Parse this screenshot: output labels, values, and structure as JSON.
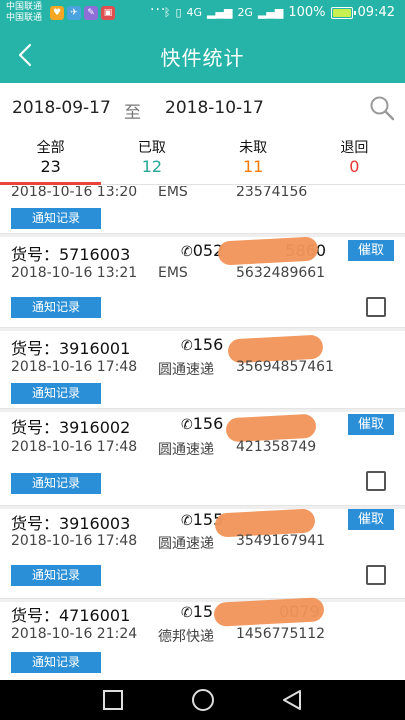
{
  "status_bar": {
    "carrier_1": "中国联通",
    "carrier_2": "中国联通",
    "dots": "···",
    "net_4g": "4G",
    "net_2g": "2G",
    "battery_text": "100%",
    "time": "09:42"
  },
  "header": {
    "title": "快件统计"
  },
  "date_range": {
    "start": "2018-09-17",
    "separator": "至",
    "end": "2018-10-17"
  },
  "tabs": [
    {
      "label": "全部",
      "count": "23",
      "color": "#111111"
    },
    {
      "label": "已取",
      "count": "12",
      "color": "#26a69a"
    },
    {
      "label": "未取",
      "count": "11",
      "color": "#f57c00"
    },
    {
      "label": "退回",
      "count": "0",
      "color": "#e53935"
    }
  ],
  "labels": {
    "notify": "通知记录",
    "urge": "催取",
    "phone_icon": "✆"
  },
  "items": [
    {
      "time": "2018-10-16 13:20",
      "company": "EMS",
      "tracking": "23574156"
    },
    {
      "parcel": "货号：5716003",
      "phone": "052",
      "phone_tail": "5860",
      "time": "2018-10-16 13:21",
      "company": "EMS",
      "tracking": "5632489661"
    },
    {
      "parcel": "货号：3916001",
      "phone": "156",
      "time": "2018-10-16 17:48",
      "company": "圆通速递",
      "tracking": "35694857461"
    },
    {
      "parcel": "货号：3916002",
      "phone": "156",
      "time": "2018-10-16 17:48",
      "company": "圆通速递",
      "tracking": "421358749"
    },
    {
      "parcel": "货号：3916003",
      "phone": "155",
      "time": "2018-10-16 17:48",
      "company": "圆通速递",
      "tracking": "3549167941"
    },
    {
      "parcel": "货号：4716001",
      "phone": "15",
      "phone_tail": "0079",
      "time": "2018-10-16 21:24",
      "company": "德邦快递",
      "tracking": "1456775112"
    }
  ]
}
